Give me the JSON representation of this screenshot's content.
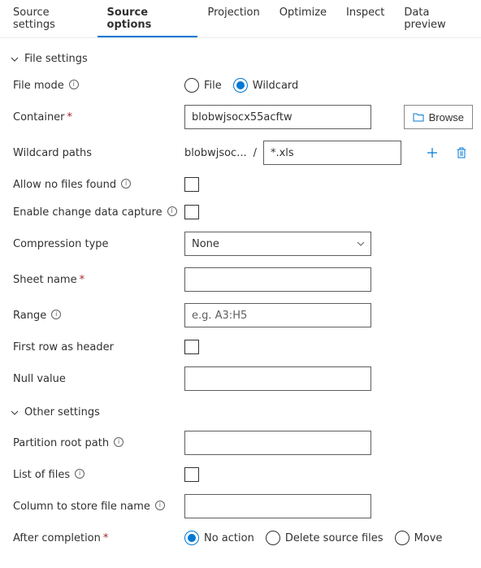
{
  "tabs": {
    "t0": "Source settings",
    "t1": "Source options",
    "t2": "Projection",
    "t3": "Optimize",
    "t4": "Inspect",
    "t5": "Data preview"
  },
  "sections": {
    "file_settings": "File settings",
    "other_settings": "Other settings"
  },
  "labels": {
    "file_mode": "File mode",
    "container": "Container",
    "wildcard_paths": "Wildcard paths",
    "allow_no_files": "Allow no files found",
    "enable_cdc": "Enable change data capture",
    "compression_type": "Compression type",
    "sheet_name": "Sheet name",
    "range": "Range",
    "first_row_header": "First row as header",
    "null_value": "Null value",
    "partition_root": "Partition root path",
    "list_of_files": "List of files",
    "column_store_filename": "Column to store file name",
    "after_completion": "After completion"
  },
  "file_mode": {
    "file": "File",
    "wildcard": "Wildcard",
    "selected": "wildcard"
  },
  "container": {
    "value": "blobwjsocx55acftw",
    "browse": "Browse"
  },
  "wildcard": {
    "prefix": "blobwjsoc...",
    "path_value": "*.xls"
  },
  "compression": {
    "value": "None"
  },
  "range": {
    "placeholder": "e.g. A3:H5"
  },
  "after_completion": {
    "no_action": "No action",
    "delete": "Delete source files",
    "move": "Move",
    "selected": "no_action"
  },
  "colors": {
    "accent": "#0078d4"
  }
}
